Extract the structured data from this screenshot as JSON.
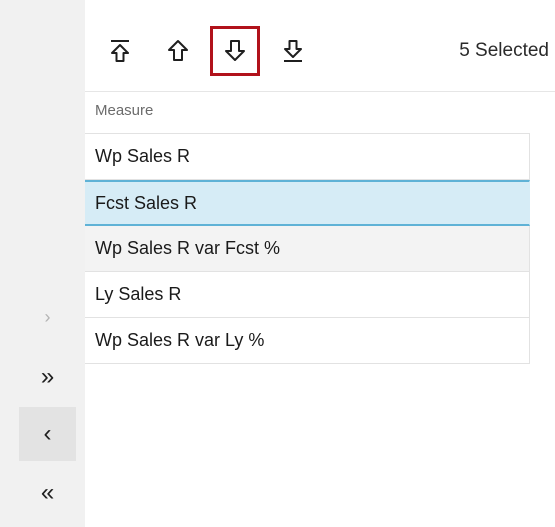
{
  "toolbar": {
    "buttons": [
      {
        "name": "move-to-top-icon"
      },
      {
        "name": "move-up-icon"
      },
      {
        "name": "move-down-icon"
      },
      {
        "name": "move-to-bottom-icon"
      }
    ],
    "selected_label": "5 Selected"
  },
  "rail": {
    "buttons": [
      {
        "name": "chevron-right-icon",
        "glyph": "›",
        "state": "disabled"
      },
      {
        "name": "double-chevron-right-icon",
        "glyph": "»",
        "state": "enabled"
      },
      {
        "name": "chevron-left-icon",
        "glyph": "‹",
        "state": "active"
      },
      {
        "name": "double-chevron-left-icon",
        "glyph": "«",
        "state": "enabled"
      }
    ]
  },
  "list": {
    "header": "Measure",
    "items": [
      {
        "label": "Wp Sales R",
        "state": "normal"
      },
      {
        "label": "Fcst Sales R",
        "state": "selected"
      },
      {
        "label": "Wp Sales R var Fcst %",
        "state": "shaded"
      },
      {
        "label": "Ly Sales R",
        "state": "normal"
      },
      {
        "label": "Wp Sales R var Ly %",
        "state": "normal"
      }
    ]
  },
  "colors": {
    "highlight_border": "#b1121b",
    "selected_row_bg": "#d6ecf6",
    "selected_row_border": "#5fb2d6",
    "rail_bg": "#f1f1f1"
  }
}
